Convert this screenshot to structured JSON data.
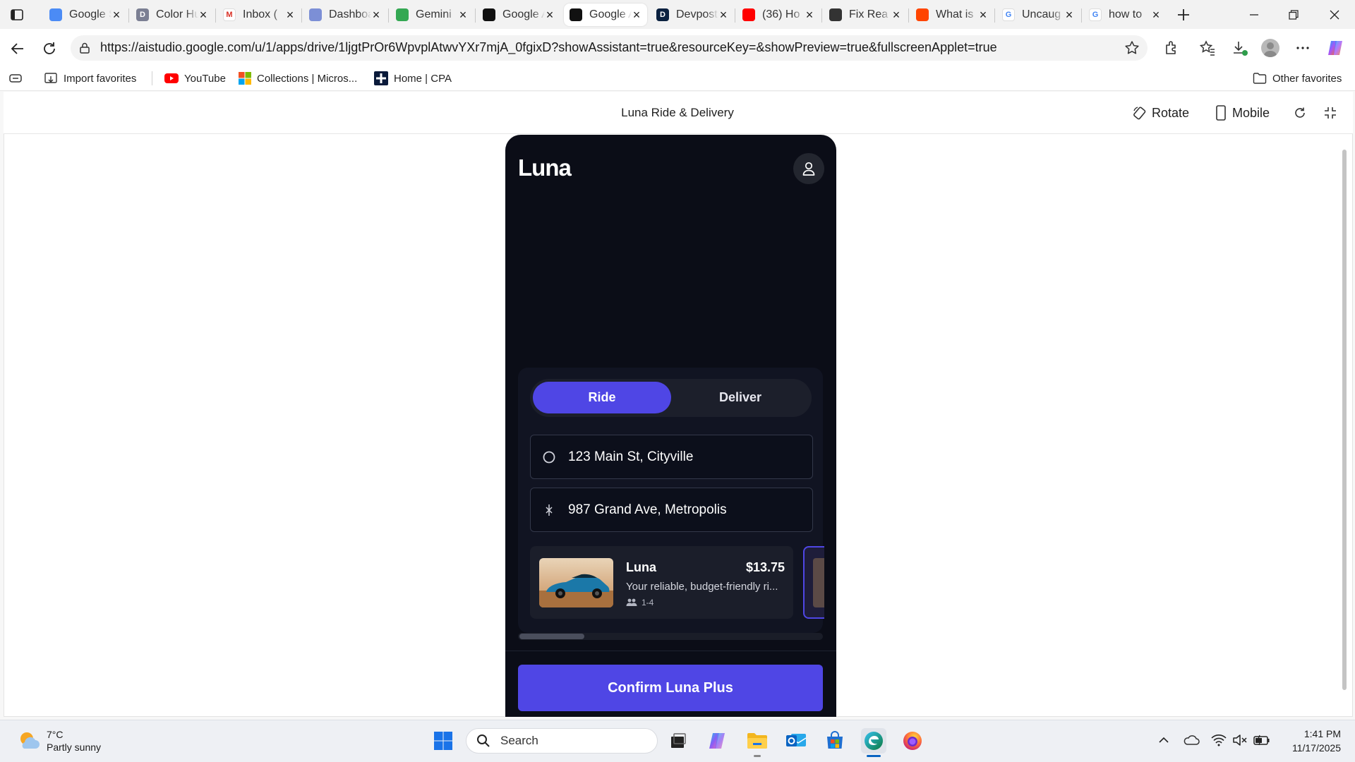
{
  "browser": {
    "tabs": [
      {
        "title": "Google Slides",
        "fav": "#4b8bf5",
        "glyph": ""
      },
      {
        "title": "Color Hunt",
        "fav": "#7b7f93",
        "glyph": "D"
      },
      {
        "title": "Inbox (",
        "fav": "#ffffff",
        "glyph": "M"
      },
      {
        "title": "Dashboard",
        "fav": "#7c8fd6",
        "glyph": ""
      },
      {
        "title": "Gemini",
        "fav": "#34a853",
        "glyph": ""
      },
      {
        "title": "Google AI",
        "fav": "#111111",
        "glyph": ""
      },
      {
        "title": "Google AI",
        "fav": "#111111",
        "glyph": ""
      },
      {
        "title": "Devpost",
        "fav": "#0b2140",
        "glyph": "D"
      },
      {
        "title": "(36) Ho",
        "fav": "#ff0000",
        "glyph": ""
      },
      {
        "title": "Fix Rea",
        "fav": "#333333",
        "glyph": ""
      },
      {
        "title": "What is",
        "fav": "#ff4500",
        "glyph": ""
      },
      {
        "title": "Uncaug",
        "fav": "#ffffff",
        "glyph": "G"
      },
      {
        "title": "how to",
        "fav": "#ffffff",
        "glyph": "G"
      }
    ],
    "url": "https://aistudio.google.com/u/1/apps/drive/1ljgtPrOr6WpvplAtwvYXr7mjA_0fgixD?showAssistant=true&resourceKey=&showPreview=true&fullscreenApplet=true",
    "favorites": {
      "import": "Import favorites",
      "youtube": "YouTube",
      "collections": "Collections | Micros...",
      "cpa": "Home | CPA",
      "other": "Other favorites"
    }
  },
  "applet": {
    "title": "Luna Ride & Delivery",
    "rotate": "Rotate",
    "mobile": "Mobile"
  },
  "app": {
    "brand": "Luna",
    "tabs": {
      "ride": "Ride",
      "deliver": "Deliver"
    },
    "pickup": "123 Main St, Cityville",
    "dropoff": "987 Grand Ave, Metropolis",
    "ride_option": {
      "name": "Luna",
      "price": "$13.75",
      "desc": "Your reliable, budget-friendly ri...",
      "capacity": "1-4"
    },
    "confirm": "Confirm Luna Plus",
    "accent": "#4f46e5"
  },
  "taskbar": {
    "weather_temp": "7°C",
    "weather_desc": "Partly sunny",
    "search": "Search",
    "time": "1:41 PM",
    "date": "11/17/2025"
  }
}
